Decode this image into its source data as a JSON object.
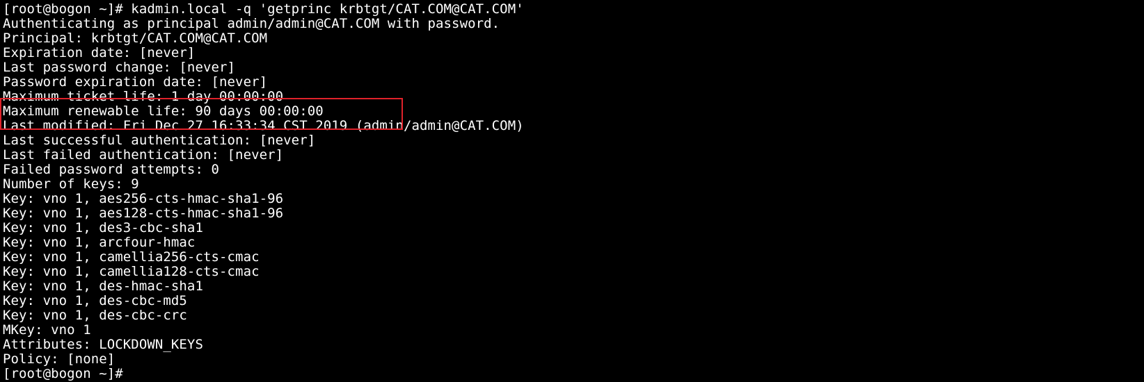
{
  "terminal": {
    "lines": [
      "[root@bogon ~]# kadmin.local -q 'getprinc krbtgt/CAT.COM@CAT.COM'",
      "Authenticating as principal admin/admin@CAT.COM with password.",
      "Principal: krbtgt/CAT.COM@CAT.COM",
      "Expiration date: [never]",
      "Last password change: [never]",
      "Password expiration date: [never]",
      "Maximum ticket life: 1 day 00:00:00",
      "Maximum renewable life: 90 days 00:00:00",
      "Last modified: Fri Dec 27 16:33:34 CST 2019 (admin/admin@CAT.COM)",
      "Last successful authentication: [never]",
      "Last failed authentication: [never]",
      "Failed password attempts: 0",
      "Number of keys: 9",
      "Key: vno 1, aes256-cts-hmac-sha1-96",
      "Key: vno 1, aes128-cts-hmac-sha1-96",
      "Key: vno 1, des3-cbc-sha1",
      "Key: vno 1, arcfour-hmac",
      "Key: vno 1, camellia256-cts-cmac",
      "Key: vno 1, camellia128-cts-cmac",
      "Key: vno 1, des-hmac-sha1",
      "Key: vno 1, des-cbc-md5",
      "Key: vno 1, des-cbc-crc",
      "MKey: vno 1",
      "Attributes: LOCKDOWN_KEYS",
      "Policy: [none]",
      "[root@bogon ~]#"
    ],
    "colors": {
      "background": "#000000",
      "text": "#ffffff",
      "highlight_border": "#e0222a"
    }
  }
}
